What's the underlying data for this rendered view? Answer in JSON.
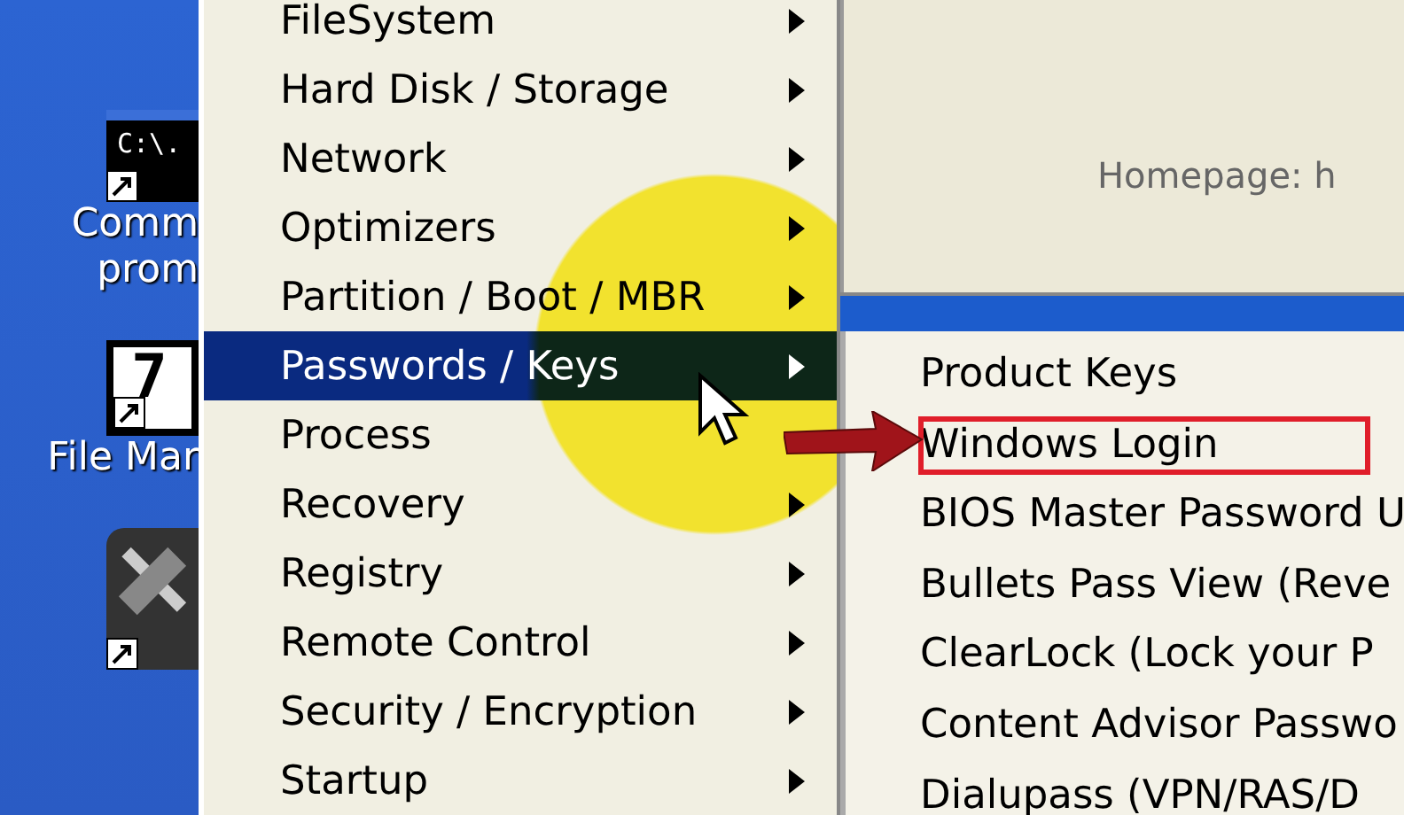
{
  "desktop": {
    "icons": [
      {
        "kind": "console",
        "glyph": "C:\\.",
        "label_lines": [
          "Comm",
          "prom"
        ]
      },
      {
        "kind": "archive",
        "glyph": "7",
        "label_lines": [
          "File Mar"
        ]
      },
      {
        "kind": "tools"
      }
    ]
  },
  "menu": {
    "items": [
      {
        "label": "FileSystem",
        "submenu": true,
        "selected": false
      },
      {
        "label": "Hard Disk / Storage",
        "submenu": true,
        "selected": false
      },
      {
        "label": "Network",
        "submenu": true,
        "selected": false
      },
      {
        "label": "Optimizers",
        "submenu": true,
        "selected": false
      },
      {
        "label": "Partition / Boot / MBR",
        "submenu": true,
        "selected": false
      },
      {
        "label": "Passwords / Keys",
        "submenu": true,
        "selected": true
      },
      {
        "label": "Process",
        "submenu": false,
        "selected": false
      },
      {
        "label": "Recovery",
        "submenu": true,
        "selected": false
      },
      {
        "label": "Registry",
        "submenu": true,
        "selected": false
      },
      {
        "label": "Remote Control",
        "submenu": true,
        "selected": false
      },
      {
        "label": "Security / Encryption",
        "submenu": true,
        "selected": false
      },
      {
        "label": "Startup",
        "submenu": true,
        "selected": false
      }
    ]
  },
  "window": {
    "homepage": "Homepage: h"
  },
  "submenu": {
    "items": [
      {
        "label": "Product Keys",
        "highlighted": false
      },
      {
        "label": "Windows Login",
        "highlighted": true
      },
      {
        "label": "BIOS Master Password U",
        "highlighted": false
      },
      {
        "label": "Bullets Pass View (Reve",
        "highlighted": false
      },
      {
        "label": "ClearLock (Lock your P",
        "highlighted": false
      },
      {
        "label": "Content Advisor Passwo",
        "highlighted": false
      },
      {
        "label": "Dialupass (VPN/RAS/D",
        "highlighted": false
      }
    ]
  }
}
